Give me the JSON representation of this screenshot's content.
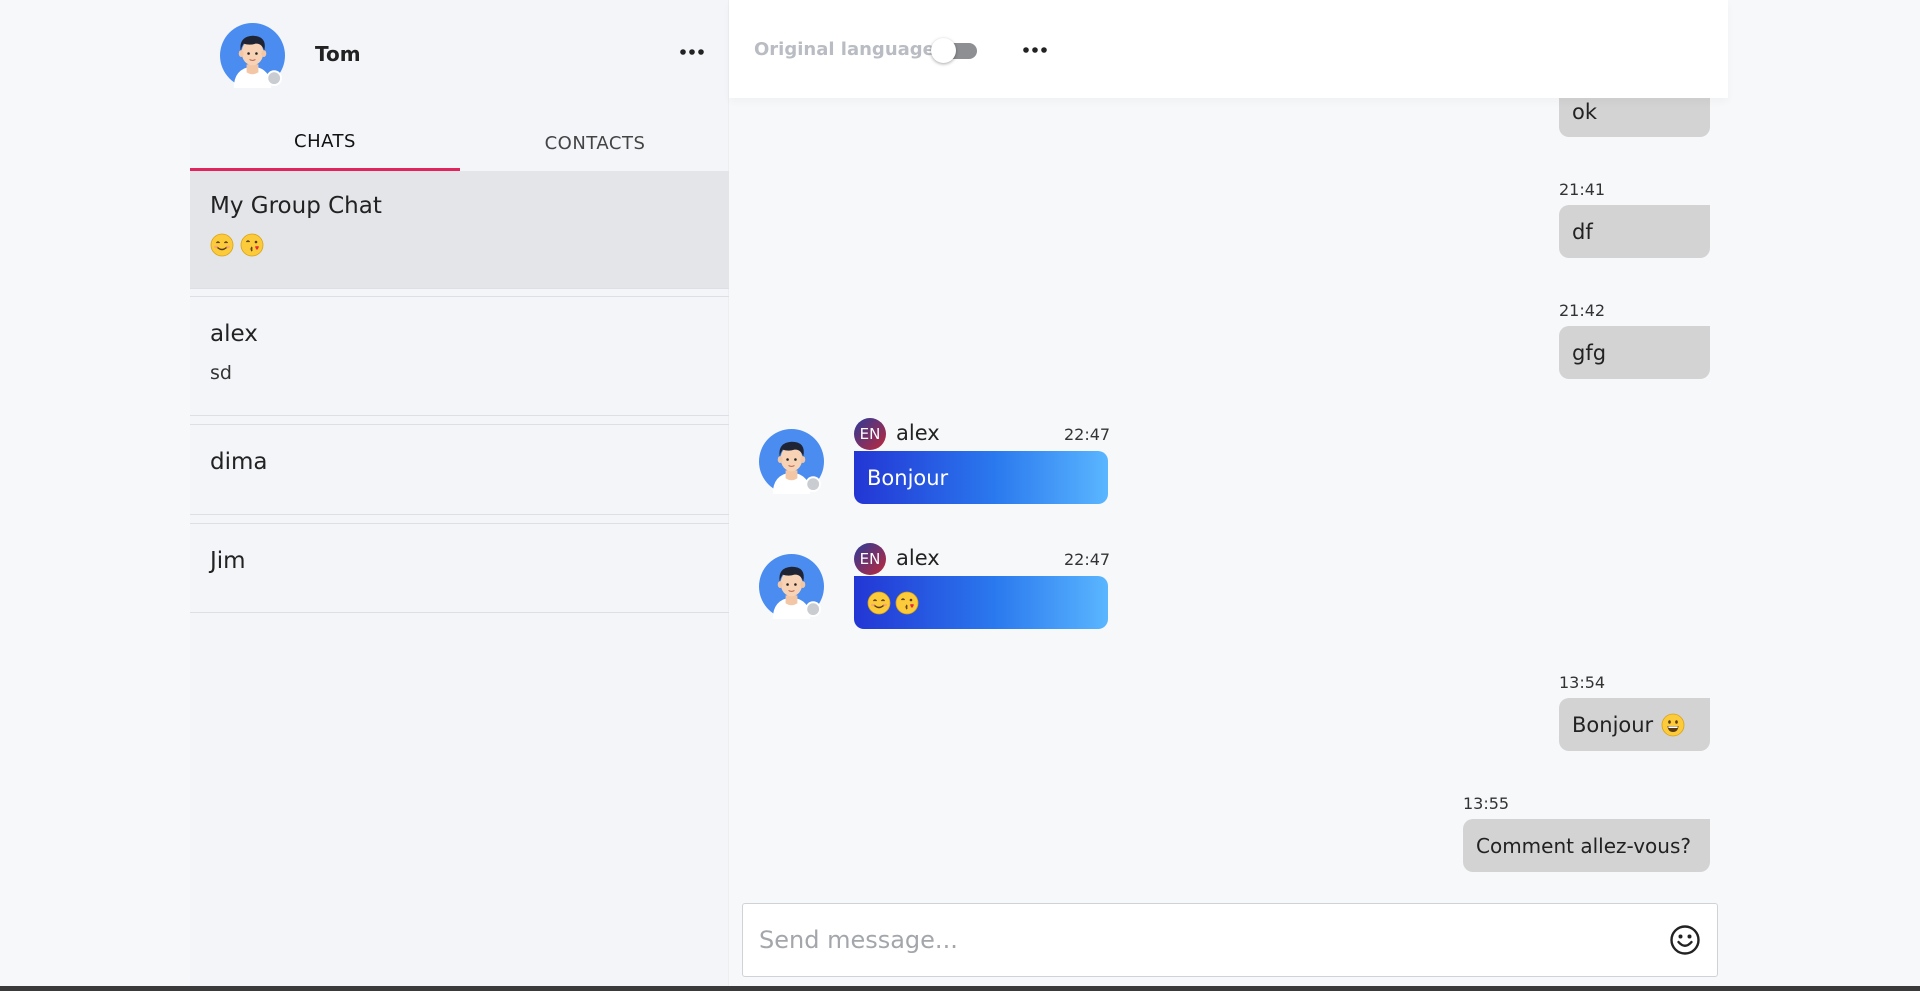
{
  "user": {
    "name": "Tom"
  },
  "tabs": [
    {
      "label": "CHATS",
      "active": true
    },
    {
      "label": "CONTACTS",
      "active": false
    }
  ],
  "chats": [
    {
      "title": "My Group Chat",
      "preview_emojis": [
        "smiling-face",
        "face-blowing-kiss"
      ],
      "selected": true
    },
    {
      "title": "alex",
      "preview": "sd"
    },
    {
      "title": "dima"
    },
    {
      "title": "Jim"
    }
  ],
  "header": {
    "original_language_label": "Original language",
    "toggle_on": false
  },
  "messages": {
    "outgoing": [
      {
        "time": "",
        "text": "ok"
      },
      {
        "time": "21:41",
        "text": "df"
      },
      {
        "time": "21:42",
        "text": "gfg"
      },
      {
        "time": "13:54",
        "text": "Bonjour",
        "emoji": "grinning-face"
      },
      {
        "time": "13:55",
        "text": "Comment allez-vous?"
      }
    ],
    "incoming": [
      {
        "author": "alex",
        "lang": "EN",
        "time": "22:47",
        "text": "Bonjour"
      },
      {
        "author": "alex",
        "lang": "EN",
        "time": "22:47",
        "text": "",
        "emojis": [
          "smiling-face",
          "face-blowing-kiss"
        ]
      }
    ]
  },
  "composer": {
    "placeholder": "Send message..."
  },
  "colors": {
    "accent_tab": "#e0245e",
    "incoming_gradient_start": "#2336d4",
    "incoming_gradient_end": "#5ab6ff",
    "outgoing_bubble": "#d3d3d3"
  }
}
